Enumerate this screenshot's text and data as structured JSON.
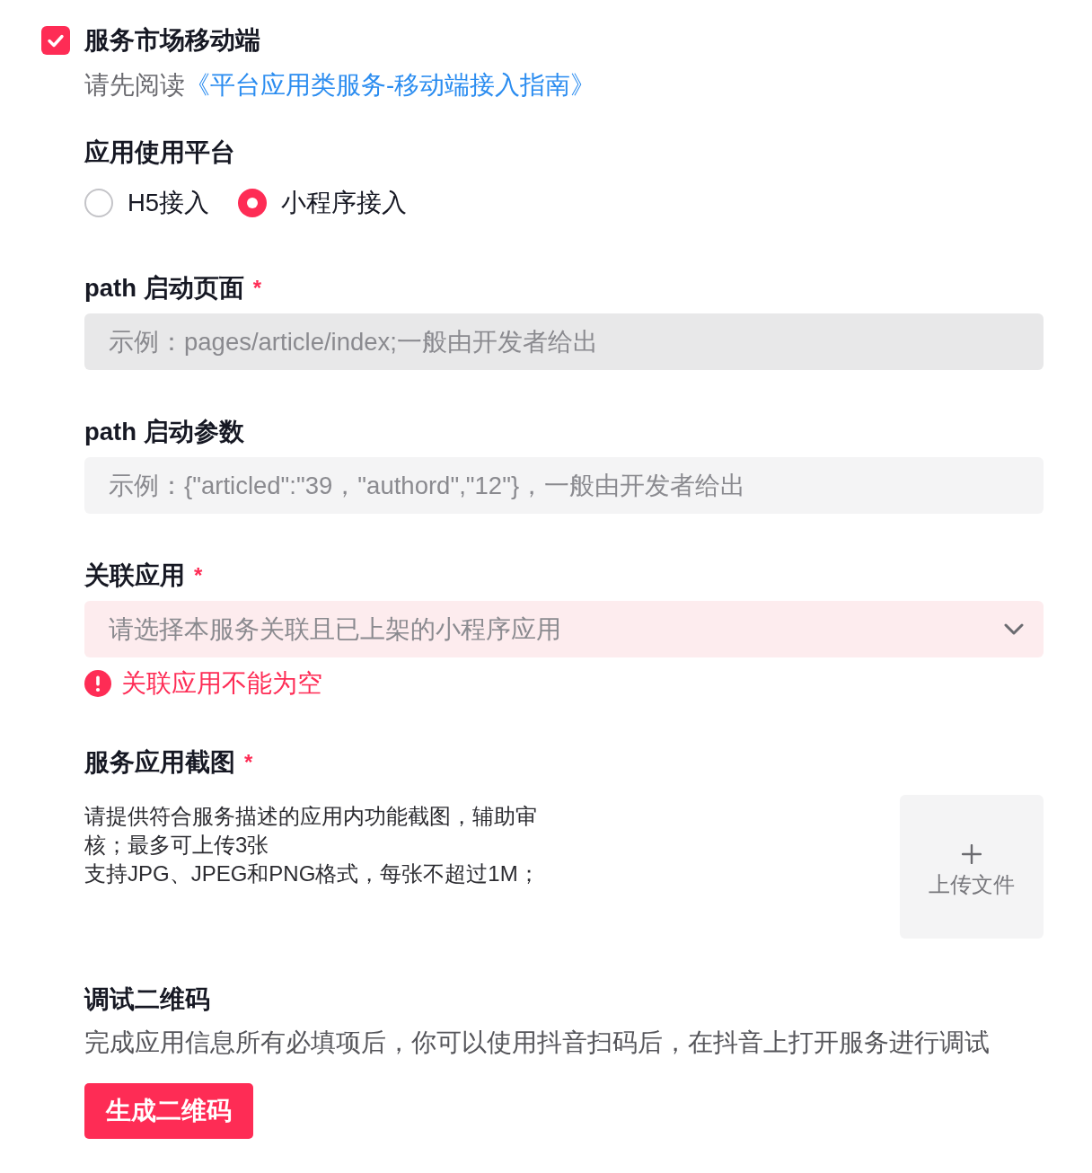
{
  "service": {
    "checkbox": {
      "label": "服务市场移动端",
      "checked": true
    },
    "notice": {
      "text": "请先阅读",
      "link": "《平台应用类服务-移动端接入指南》"
    }
  },
  "platform": {
    "label": "应用使用平台",
    "options": [
      {
        "label": "H5接入",
        "selected": false
      },
      {
        "label": "小程序接入",
        "selected": true
      }
    ]
  },
  "fields": [
    {
      "kind": "input",
      "label": "path 启动页面",
      "required_mark": "*",
      "placeholder": "示例：pages/article/index;一般由开发者给出",
      "hovered": true
    },
    {
      "kind": "input",
      "label": "path 启动参数",
      "placeholder": "示例：{\"articled\":\"39，\"authord\",\"12\"}，一般由开发者给出",
      "hovered": false
    },
    {
      "kind": "select",
      "label": "关联应用",
      "required_mark": "*",
      "placeholder": "请选择本服务关联且已上架的小程序应用",
      "error": "关联应用不能为空"
    }
  ],
  "screenshots": {
    "label": "服务应用截图",
    "required_mark": "*",
    "hints": [
      "请提供符合服务描述的应用内功能截图，辅助审核；最多可上传3张",
      "支持JPG、JPEG和PNG格式，每张不超过1M；"
    ],
    "upload_button": "上传文件"
  },
  "debug": {
    "label": "调试二维码",
    "description": "完成应用信息所有必填项后，你可以使用抖音扫码后，在抖音上打开服务进行调试",
    "button": "生成二维码"
  }
}
